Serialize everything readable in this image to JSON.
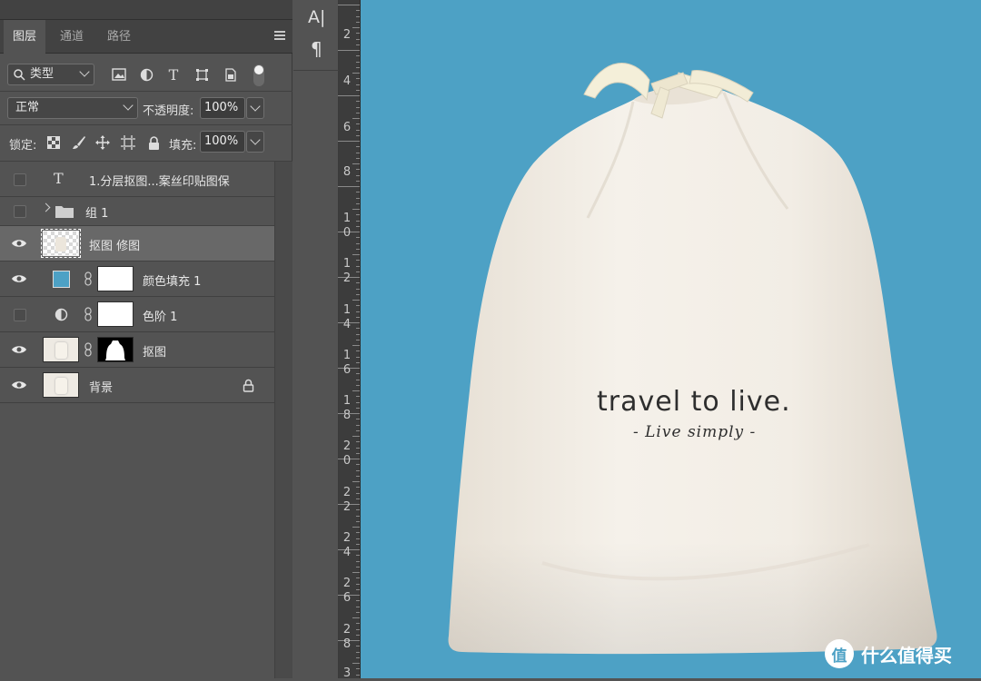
{
  "tabs": [
    "图层",
    "通道",
    "路径"
  ],
  "filter": {
    "kind_label": "类型"
  },
  "blend": {
    "mode": "正常",
    "opacity_label": "不透明度:",
    "opacity_value": "100%"
  },
  "lock": {
    "label": "锁定:",
    "fill_label": "填充:",
    "fill_value": "100%"
  },
  "layers": [
    {
      "name": "1.分层抠图...案丝印贴图保",
      "visible": false,
      "type": "text"
    },
    {
      "name": "组 1",
      "visible": false,
      "type": "group"
    },
    {
      "name": "抠图 修图",
      "visible": true,
      "type": "image",
      "selected": true
    },
    {
      "name": "颜色填充 1",
      "visible": true,
      "type": "fill"
    },
    {
      "name": "色阶 1",
      "visible": false,
      "type": "adjustment"
    },
    {
      "name": "抠图",
      "visible": true,
      "type": "masked"
    },
    {
      "name": "背景",
      "visible": true,
      "type": "background"
    }
  ],
  "mid_tools": [
    "A|",
    "¶"
  ],
  "ruler_numbers": [
    [
      "2"
    ],
    [
      "4"
    ],
    [
      "6"
    ],
    [
      "8"
    ],
    [
      "1",
      "0"
    ],
    [
      "1",
      "2"
    ],
    [
      "1",
      "4"
    ],
    [
      "1",
      "6"
    ],
    [
      "1",
      "8"
    ],
    [
      "2",
      "0"
    ],
    [
      "2",
      "2"
    ],
    [
      "2",
      "4"
    ],
    [
      "2",
      "6"
    ],
    [
      "2",
      "8"
    ],
    [
      "3"
    ]
  ],
  "canvas": {
    "background_color": "#4da1c5",
    "bag_text_main": "travel to live.",
    "bag_text_sub": "- Live simply -"
  },
  "watermark": {
    "text": "什么值得买",
    "logo_glyph": "值"
  }
}
